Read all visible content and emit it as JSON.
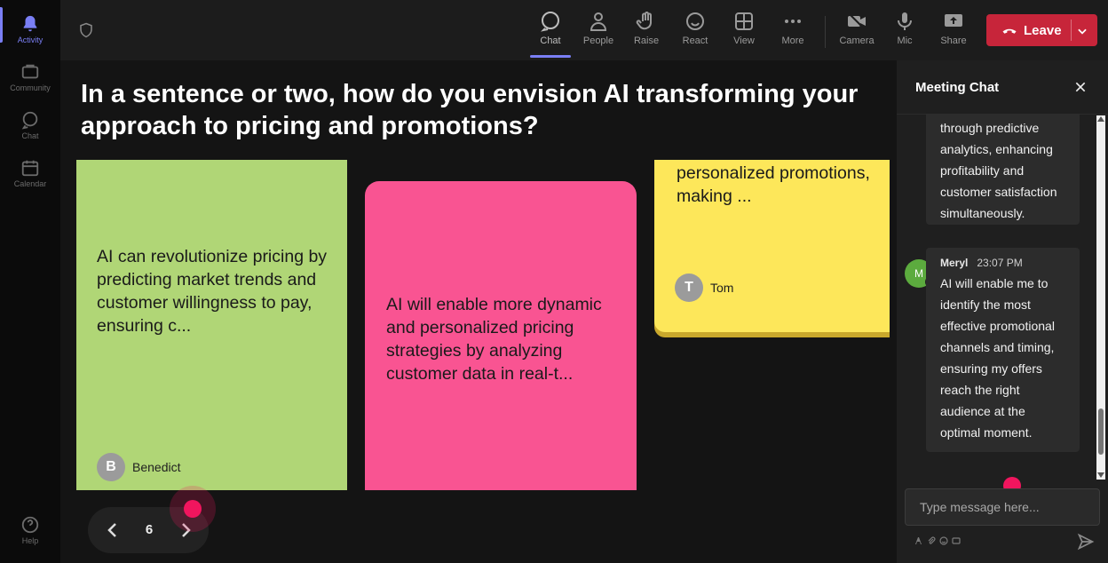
{
  "rail": {
    "items": [
      {
        "label": "Activity",
        "icon": "bell-icon"
      },
      {
        "label": "Community",
        "icon": "community-icon"
      },
      {
        "label": "Chat",
        "icon": "chat-icon"
      },
      {
        "label": "Calendar",
        "icon": "calendar-icon"
      },
      {
        "label": "Help",
        "icon": "help-icon"
      }
    ]
  },
  "toolbar": {
    "chat": "Chat",
    "people": "People",
    "raise": "Raise",
    "react": "React",
    "view": "View",
    "more": "More",
    "camera": "Camera",
    "mic": "Mic",
    "share": "Share",
    "leave": "Leave"
  },
  "stage": {
    "question": "In a sentence or two, how do you envision AI transforming your\napproach to pricing and promotions?",
    "notes": [
      {
        "text": "AI can revolutionize pricing by predicting market trends and customer willingness to pay, ensuring c...",
        "author": "Benedict",
        "initial": "B",
        "color": "#b0d676"
      },
      {
        "text": "AI will enable more dynamic and personalized pricing strategies by analyzing customer data in real-t...",
        "color": "#f95492"
      },
      {
        "text": "personalized promotions, making ...",
        "author": "Tom",
        "initial": "T",
        "color": "#fde75a"
      }
    ],
    "page": "6"
  },
  "chat": {
    "title": "Meeting Chat",
    "messages": [
      {
        "text": "through predictive\nanalytics, enhancing\nprofitability and\ncustomer satisfaction\nsimultaneously."
      },
      {
        "author": "Meryl",
        "initial": "M",
        "time": "23:07 PM",
        "text": "AI will enable me to\nidentify the most\neffective promotional\nchannels and timing,\nensuring my offers\nreach the right\naudience at the\noptimal moment."
      }
    ],
    "input_placeholder": "Type message here..."
  }
}
